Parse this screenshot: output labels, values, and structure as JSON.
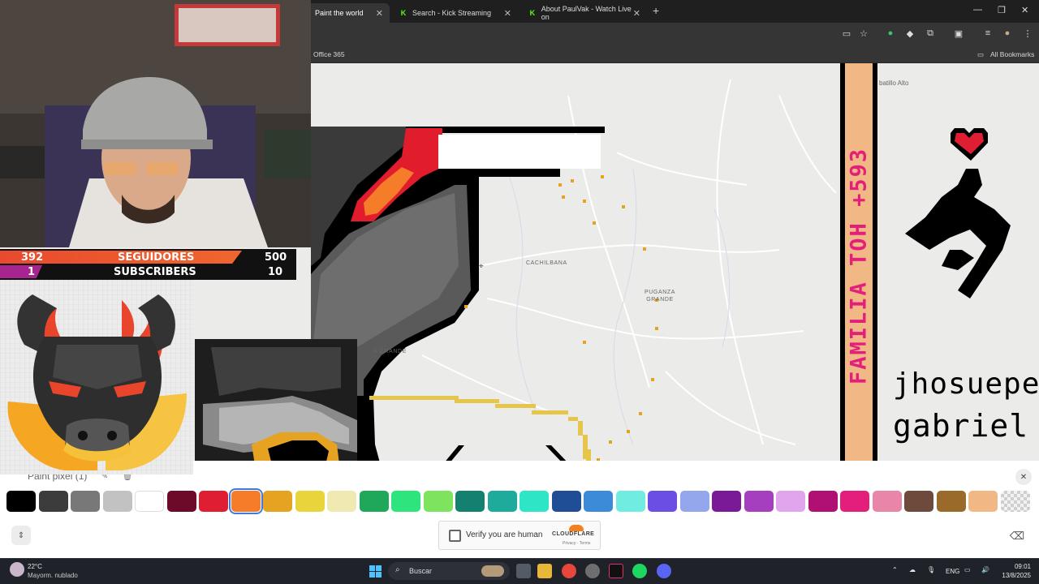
{
  "browser": {
    "tabs": [
      {
        "label": "Paint the world",
        "active": true
      },
      {
        "label": "Search - Kick Streaming",
        "active": false
      },
      {
        "label": "About PaulVak - Watch Live on",
        "active": false
      }
    ],
    "bookmarks": {
      "left": "Office 365",
      "right": "All Bookmarks"
    }
  },
  "map": {
    "labels": {
      "cachilbana": "CACHILBANA",
      "puganza_1": "PUGANZA",
      "puganza_2": "GRANDE",
      "left_grande": "A GRANDE",
      "tabillo": "batillo Alto"
    },
    "pixel_art": {
      "vertical_banner": "FAMILIA TOH +593",
      "name_1": "jhosuepe.",
      "name_2": "gabriel"
    }
  },
  "overlay": {
    "stats": {
      "followers_current": "392",
      "followers_label": "SEGUIDORES",
      "followers_goal": "500",
      "subs_current": "1",
      "subs_label": "SUBSCRIBERS",
      "subs_goal": "10"
    }
  },
  "paint": {
    "label": "Paint pixel (1)",
    "colors": [
      "#000000",
      "#3c3c3c",
      "#787878",
      "#c2c2c2",
      "#ffffff",
      "#6d0a2a",
      "#e01e33",
      "#f57c28",
      "#e5a321",
      "#e8d43b",
      "#f0eab2",
      "#1fa85a",
      "#2ee57d",
      "#7ee35d",
      "#14806f",
      "#1fab9c",
      "#2ee5c5",
      "#1f4e97",
      "#3b8bd8",
      "#70ece0",
      "#6b4ee3",
      "#94a6ec",
      "#7a1a97",
      "#a53fc0",
      "#e1a5ed",
      "#b00f73",
      "#e41f7b",
      "#e885a8",
      "#6e4a3c",
      "#9a6a2a",
      "#f1b784",
      "#dddddd"
    ],
    "selected_index": 7,
    "captcha": {
      "text": "Verify you are human",
      "brand": "CLOUDFLARE",
      "sub": "Privacy · Terms"
    }
  },
  "taskbar": {
    "weather_temp": "22°C",
    "weather_desc": "Mayorm. nublado",
    "search_placeholder": "Buscar",
    "lang": "ENG",
    "time": "09:01",
    "date": "13/8/2025"
  }
}
